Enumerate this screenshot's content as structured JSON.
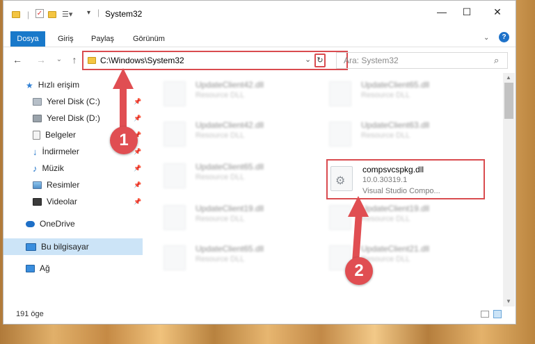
{
  "window": {
    "title": "System32"
  },
  "ribbon": {
    "tabs": [
      "Dosya",
      "Giriş",
      "Paylaş",
      "Görünüm"
    ],
    "help": "?"
  },
  "address": {
    "path": "C:\\Windows\\System32",
    "search_placeholder": "Ara: System32"
  },
  "sidebar": {
    "quick_access": "Hızlı erişim",
    "items": [
      "Yerel Disk (C:)",
      "Yerel Disk (D:)",
      "Belgeler",
      "İndirmeler",
      "Müzik",
      "Resimler",
      "Videolar"
    ],
    "onedrive": "OneDrive",
    "this_pc": "Bu bilgisayar",
    "network": "Ağ"
  },
  "files": {
    "left": [
      {
        "name": "UpdateClient42.dll",
        "type": "Resource DLL"
      },
      {
        "name": "UpdateClient42.dll",
        "type": "Resource DLL"
      },
      {
        "name": "UpdateClient65.dll",
        "type": "Resource DLL"
      },
      {
        "name": "UpdateClient19.dll",
        "type": "Resource DLL"
      },
      {
        "name": "UpdateClient65.dll",
        "type": "Resource DLL"
      }
    ],
    "right": [
      {
        "name": "UpdateClient65.dll",
        "type": "Resource DLL"
      },
      {
        "name": "UpdateClient63.dll",
        "type": "Resource DLL"
      },
      {
        "name": "UpdateClient19.dll",
        "type": "Resource DLL"
      },
      {
        "name": "UpdateClient21.dll",
        "type": "Resource DLL"
      }
    ],
    "target": {
      "name": "compsvcspkg.dll",
      "version": "10.0.30319.1",
      "description": "Visual Studio Compo..."
    }
  },
  "status": {
    "item_count": "191 öge"
  },
  "annotations": {
    "step1": "1",
    "step2": "2"
  },
  "colors": {
    "highlight": "#d94b4f",
    "accent": "#1979ca",
    "selection": "#cce4f7"
  }
}
